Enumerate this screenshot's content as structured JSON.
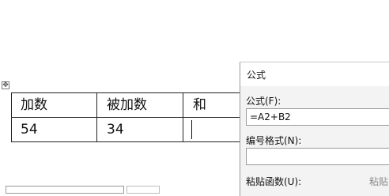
{
  "table": {
    "headers": [
      "加数",
      "被加数",
      "和"
    ],
    "row1": [
      "54",
      "34",
      ""
    ]
  },
  "dialog": {
    "title": "公式",
    "formula_label": "公式(F):",
    "formula_value": "=A2+B2",
    "number_format_label": "编号格式(N):",
    "number_format_value": "",
    "paste_function_label": "粘贴函数(U):",
    "paste_bookmark_label": "粘贴"
  },
  "icons": {
    "move_handle": "table-move-handle-icon"
  }
}
